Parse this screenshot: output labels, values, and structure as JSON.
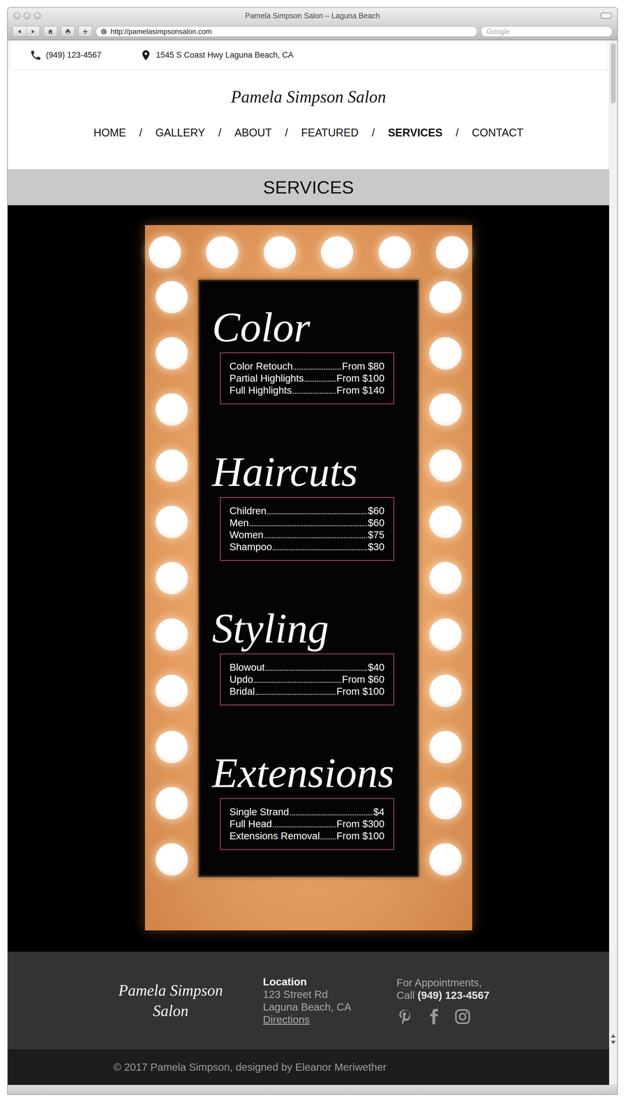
{
  "window": {
    "title": "Pamela Simpson Salon – Laguna Beach"
  },
  "browser": {
    "url": "http://pamelasimpsonsalon.com",
    "search_placeholder": "Google"
  },
  "contact_bar": {
    "phone": "(949) 123-4567",
    "address": "1545 S Coast Hwy Laguna Beach, CA"
  },
  "logo": "Pamela Simpson Salon",
  "nav": {
    "separator": "/",
    "items": [
      {
        "label": "HOME",
        "selected": false
      },
      {
        "label": "GALLERY",
        "selected": false
      },
      {
        "label": "ABOUT",
        "selected": false
      },
      {
        "label": "FEATURED",
        "selected": false
      },
      {
        "label": "SERVICES",
        "selected": true
      },
      {
        "label": "CONTACT",
        "selected": false
      }
    ]
  },
  "page_title": "SERVICES",
  "menu": [
    {
      "title": "Color",
      "items": [
        {
          "name": "Color Retouch",
          "price": "From $80"
        },
        {
          "name": "Partial Highlights",
          "price": "From $100"
        },
        {
          "name": "Full Highlights",
          "price": "From $140"
        }
      ]
    },
    {
      "title": "Haircuts",
      "items": [
        {
          "name": "Children",
          "price": "$60"
        },
        {
          "name": "Men",
          "price": "$60"
        },
        {
          "name": "Women",
          "price": "$75"
        },
        {
          "name": "Shampoo",
          "price": "$30"
        }
      ]
    },
    {
      "title": "Styling",
      "items": [
        {
          "name": "Blowout",
          "price": "$40"
        },
        {
          "name": "Updo",
          "price": "From $60"
        },
        {
          "name": "Bridal",
          "price": "From $100"
        }
      ]
    },
    {
      "title": "Extensions",
      "items": [
        {
          "name": "Single Strand",
          "price": "$4"
        },
        {
          "name": "Full Head",
          "price": "From $300"
        },
        {
          "name": "Extensions Removal",
          "price": "From $100"
        }
      ]
    }
  ],
  "footer": {
    "logo": "Pamela Simpson Salon",
    "location": {
      "heading": "Location",
      "lines": [
        "123 Street Rd",
        "Laguna Beach, CA"
      ],
      "link": "Directions"
    },
    "appointments": {
      "line": "For Appointments,",
      "call": "Call",
      "phone": "(949) 123-4567"
    }
  },
  "copyright": "© 2017 Pamela Simpson, designed by Eleanor Meriwether"
}
